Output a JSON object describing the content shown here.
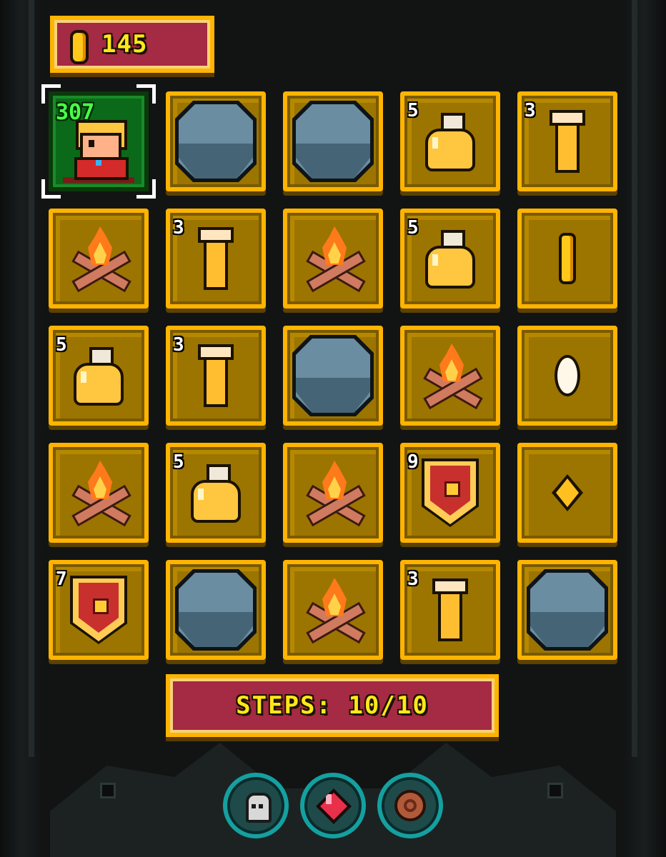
{
  "hud": {
    "coins": "145",
    "steps_label": "STEPS: 10/10"
  },
  "hero": {
    "hp": "307"
  },
  "board": {
    "rows": [
      [
        {
          "type": "hero"
        },
        {
          "type": "rock",
          "count": ""
        },
        {
          "type": "rock",
          "count": ""
        },
        {
          "type": "flask",
          "count": "5"
        },
        {
          "type": "vial",
          "count": "3"
        }
      ],
      [
        {
          "type": "campfire",
          "count": ""
        },
        {
          "type": "vial",
          "count": "3"
        },
        {
          "type": "campfire",
          "count": ""
        },
        {
          "type": "flask",
          "count": "5"
        },
        {
          "type": "coin-slim",
          "count": ""
        }
      ],
      [
        {
          "type": "flask",
          "count": "5"
        },
        {
          "type": "vial",
          "count": "3"
        },
        {
          "type": "rock",
          "count": ""
        },
        {
          "type": "campfire",
          "count": ""
        },
        {
          "type": "coin-white",
          "count": ""
        }
      ],
      [
        {
          "type": "campfire",
          "count": ""
        },
        {
          "type": "flask",
          "count": "5"
        },
        {
          "type": "campfire",
          "count": ""
        },
        {
          "type": "shield",
          "count": "9"
        },
        {
          "type": "gem-gold",
          "count": ""
        }
      ],
      [
        {
          "type": "shield",
          "count": "7"
        },
        {
          "type": "rock",
          "count": ""
        },
        {
          "type": "campfire",
          "count": ""
        },
        {
          "type": "vial",
          "count": "3"
        },
        {
          "type": "rock",
          "count": ""
        }
      ]
    ]
  },
  "abilities": [
    {
      "icon": "skull-icon"
    },
    {
      "icon": "red-crystal-icon"
    },
    {
      "icon": "bronze-coin-icon"
    }
  ],
  "colors": {
    "tile_border": "#ffb400",
    "tile_bg": "#9c7400",
    "panel": "#a52a43",
    "hud_text": "#ffe81a",
    "hero_hp": "#4bff4b"
  }
}
